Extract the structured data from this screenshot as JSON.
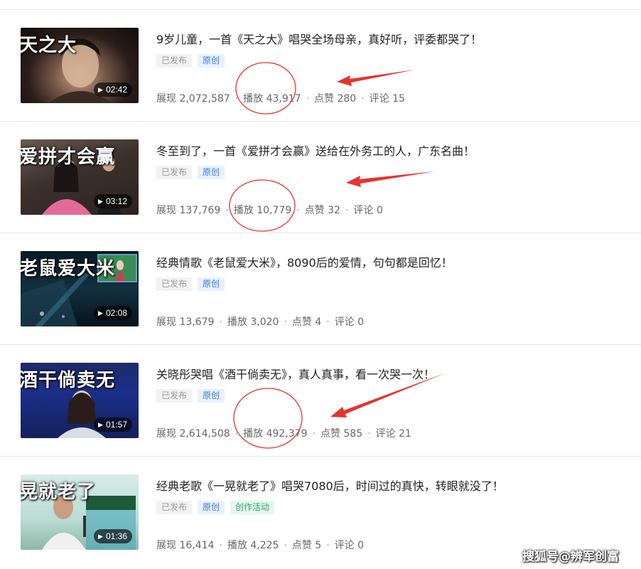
{
  "videos": [
    {
      "thumb_text": "天之大",
      "duration": "02:42",
      "title": "9岁儿童，一首《天之大》唱哭全场母亲，真好听，评委都哭了！",
      "tags": [
        "已发布",
        "原创"
      ],
      "stats": {
        "impressions": "展现 2,072,587",
        "plays": "播放 43,917",
        "likes": "点赞 280",
        "comments": "评论 15"
      }
    },
    {
      "thumb_text": "爱拼才会赢",
      "duration": "03:12",
      "title": "冬至到了，一首《爱拼才会赢》送给在外务工的人，广东名曲！",
      "tags": [
        "已发布",
        "原创"
      ],
      "stats": {
        "impressions": "展现 137,769",
        "plays": "播放 10,779",
        "likes": "点赞 32",
        "comments": "评论 0"
      }
    },
    {
      "thumb_text": "老鼠爱大米",
      "duration": "02:08",
      "title": "经典情歌《老鼠爱大米》，8090后的爱情，句句都是回忆！",
      "tags": [
        "已发布",
        "原创"
      ],
      "stats": {
        "impressions": "展现 13,679",
        "plays": "播放 3,020",
        "likes": "点赞 4",
        "comments": "评论 0"
      }
    },
    {
      "thumb_text": "酒干倘卖无",
      "duration": "01:57",
      "title": "关晓彤哭唱《酒干倘卖无》，真人真事，看一次哭一次！",
      "tags": [
        "已发布",
        "原创"
      ],
      "stats": {
        "impressions": "展现 2,614,508",
        "plays": "播放 492,379",
        "likes": "点赞 585",
        "comments": "评论 21"
      }
    },
    {
      "thumb_text": "晃就老了",
      "duration": "01:36",
      "title": "经典老歌《一晃就老了》唱哭7080后，时间过的真快，转眼就没了！",
      "tags": [
        "已发布",
        "原创",
        "创作活动"
      ],
      "stats": {
        "impressions": "展现 16,414",
        "plays": "播放 4,225",
        "likes": "点赞 5",
        "comments": "评论 0"
      }
    }
  ],
  "watermark": "搜狐号@辨军创富",
  "colors": {
    "annotation_red": "#e8322e",
    "tag_blue": "#3a7bd5",
    "tag_green": "#2aa36b"
  }
}
